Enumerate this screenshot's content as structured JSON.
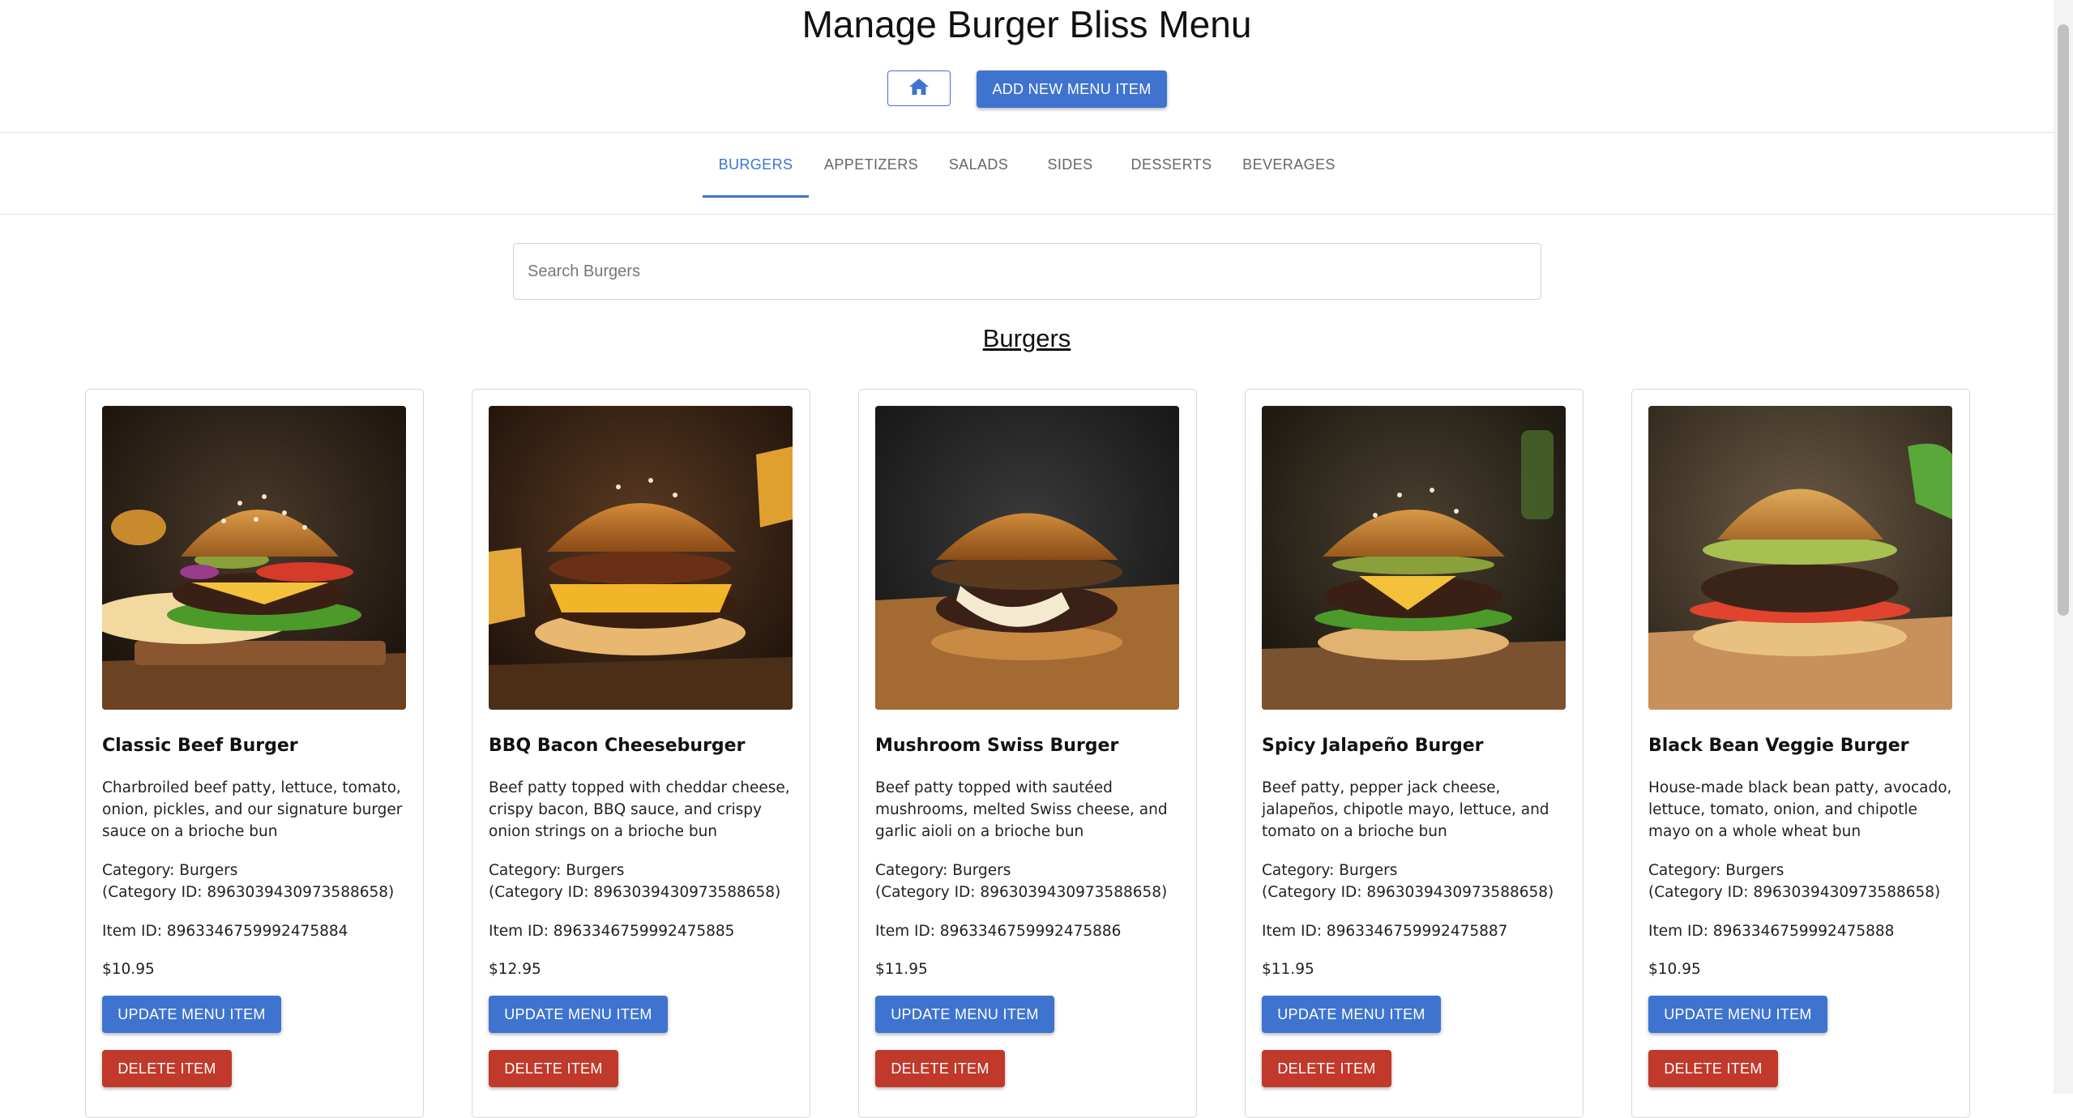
{
  "header": {
    "title": "Manage Burger Bliss Menu",
    "home_icon": "home-icon",
    "add_button_label": "ADD NEW MENU ITEM"
  },
  "tabs": [
    {
      "label": "BURGERS",
      "active": true
    },
    {
      "label": "APPETIZERS",
      "active": false
    },
    {
      "label": "SALADS",
      "active": false
    },
    {
      "label": "SIDES",
      "active": false
    },
    {
      "label": "DESSERTS",
      "active": false
    },
    {
      "label": "BEVERAGES",
      "active": false
    }
  ],
  "search": {
    "placeholder": "Search Burgers",
    "value": ""
  },
  "section": {
    "title": "Burgers"
  },
  "cards": [
    {
      "name": "Classic Beef Burger",
      "description": "Charbroiled beef patty, lettuce, tomato, onion, pickles, and our signature burger sauce on a brioche bun",
      "category": "Category: Burgers",
      "category_id": "(Category ID: 8963039430973588658)",
      "item_id": "Item ID: 8963346759992475884",
      "price": "$10.95",
      "update_label": "UPDATE MENU ITEM",
      "delete_label": "DELETE ITEM"
    },
    {
      "name": "BBQ Bacon Cheeseburger",
      "description": "Beef patty topped with cheddar cheese, crispy bacon, BBQ sauce, and crispy onion strings on a brioche bun",
      "category": "Category: Burgers",
      "category_id": "(Category ID: 8963039430973588658)",
      "item_id": "Item ID: 8963346759992475885",
      "price": "$12.95",
      "update_label": "UPDATE MENU ITEM",
      "delete_label": "DELETE ITEM"
    },
    {
      "name": "Mushroom Swiss Burger",
      "description": "Beef patty topped with sautéed mushrooms, melted Swiss cheese, and garlic aioli on a brioche bun",
      "category": "Category: Burgers",
      "category_id": "(Category ID: 8963039430973588658)",
      "item_id": "Item ID: 8963346759992475886",
      "price": "$11.95",
      "update_label": "UPDATE MENU ITEM",
      "delete_label": "DELETE ITEM"
    },
    {
      "name": "Spicy Jalapeño Burger",
      "description": "Beef patty, pepper jack cheese, jalapeños, chipotle mayo, lettuce, and tomato on a brioche bun",
      "category": "Category: Burgers",
      "category_id": "(Category ID: 8963039430973588658)",
      "item_id": "Item ID: 8963346759992475887",
      "price": "$11.95",
      "update_label": "UPDATE MENU ITEM",
      "delete_label": "DELETE ITEM"
    },
    {
      "name": "Black Bean Veggie Burger",
      "description": "House-made black bean patty, avocado, lettuce, tomato, onion, and chipotle mayo on a whole wheat bun",
      "category": "Category: Burgers",
      "category_id": "(Category ID: 8963039430973588658)",
      "item_id": "Item ID: 8963346759992475888",
      "price": "$10.95",
      "update_label": "UPDATE MENU ITEM",
      "delete_label": "DELETE ITEM"
    }
  ],
  "colors": {
    "accent": "#3e74cf",
    "danger": "#c0392b",
    "border": "#d8d8d8"
  }
}
